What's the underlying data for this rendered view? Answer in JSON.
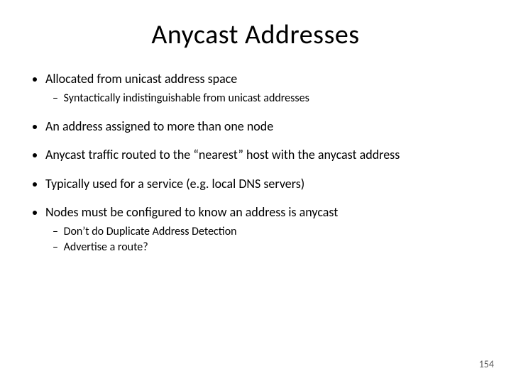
{
  "title": "Anycast Addresses",
  "bullets": {
    "b0": {
      "text": "Allocated from unicast address space",
      "sub": {
        "s0": "Syntactically indistinguishable from unicast addresses"
      }
    },
    "b1": {
      "text": "An address assigned to more than one node"
    },
    "b2": {
      "text": "Anycast traffic routed to the “nearest” host with the anycast address"
    },
    "b3": {
      "text": "Typically used for a service (e.g. local DNS servers)"
    },
    "b4": {
      "text": "Nodes must be configured to know an address is anycast",
      "sub": {
        "s0": "Don’t do Duplicate Address Detection",
        "s1": "Advertise a route?"
      }
    }
  },
  "page_number": "154"
}
